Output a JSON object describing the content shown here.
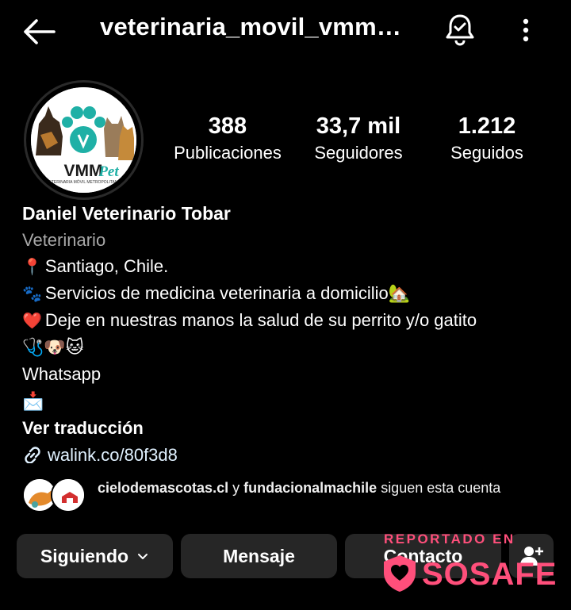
{
  "header": {
    "username": "veterinaria_movil_vmmpet",
    "back_icon": "arrow-left-icon",
    "bell_icon": "bell-icon",
    "more_icon": "more-vertical-icon"
  },
  "avatar": {
    "brand": "VMMPet",
    "tagline": "VETERINARIA MÓVIL METROPOLITANA"
  },
  "stats": [
    {
      "value": "388",
      "label": "Publicaciones"
    },
    {
      "value": "33,7 mil",
      "label": "Seguidores"
    },
    {
      "value": "1.212",
      "label": "Seguidos"
    }
  ],
  "bio": {
    "name": "Daniel Veterinario Tobar",
    "category": "Veterinario",
    "lines": [
      {
        "emoji": "📍",
        "text": "Santiago, Chile."
      },
      {
        "emoji": "🐾",
        "text": "Servicios de medicina veterinaria a domicilio🏡"
      },
      {
        "emoji": "❤️",
        "text": "Deje en nuestras manos la salud de su perrito y/o gatito"
      },
      {
        "emoji": "",
        "text": "🩺🐶🐱"
      },
      {
        "emoji": "",
        "text": "Whatsapp"
      },
      {
        "emoji": "",
        "text": "📩"
      }
    ],
    "translate": "Ver traducción",
    "link": "walink.co/80f3d8"
  },
  "followed_by": {
    "user1": "cielodemascotas.cl",
    "connector": "y",
    "user2": "fundacionalmachile",
    "suffix": "siguen esta cuenta"
  },
  "actions": {
    "following": "Siguiendo",
    "message": "Mensaje",
    "contact": "Contacto",
    "add_person_icon": "person-add-icon"
  },
  "watermark": {
    "top": "REPORTADO EN",
    "brand": "SOSAFE"
  },
  "colors": {
    "background": "#000000",
    "button": "#262626",
    "secondary_text": "#a8a8a8",
    "watermark": "#ff4f7b"
  }
}
